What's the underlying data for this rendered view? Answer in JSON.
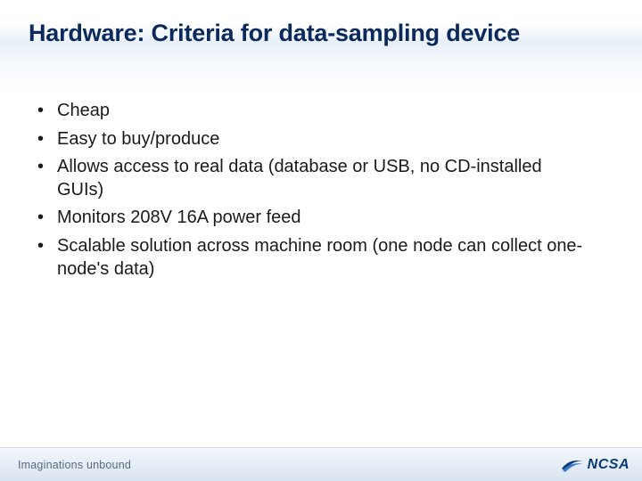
{
  "title": "Hardware: Criteria for data-sampling device",
  "bullets": [
    "Cheap",
    "Easy to buy/produce",
    "Allows access to real data (database or USB, no CD-installed GUIs)",
    "Monitors 208V 16A power feed",
    "Scalable solution across machine room (one node can collect one-node's data)"
  ],
  "footer": {
    "tagline": "Imaginations unbound",
    "logo_text": "NCSA"
  },
  "colors": {
    "title": "#0a2a5c",
    "body": "#1a1a1a",
    "footer_text": "#5a6a80",
    "logo": "#0a3a7a"
  }
}
